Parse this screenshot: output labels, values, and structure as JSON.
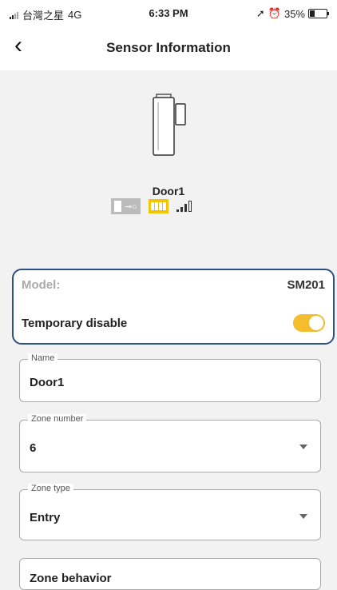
{
  "status_bar": {
    "carrier": "台灣之星",
    "network": "4G",
    "time": "6:33 PM",
    "battery_percent_label": "35%",
    "battery_level": 0.35
  },
  "nav": {
    "back_icon": "chevron-left-icon",
    "title": "Sensor Information"
  },
  "sensor": {
    "name": "Door1",
    "image_icon": "door-sensor-icon",
    "battery_icon": "battery-full-icon",
    "signal_icon": "signal-strength-icon"
  },
  "info": {
    "model_label": "Model:",
    "model_value": "SM201",
    "temporary_disable_label": "Temporary disable",
    "temporary_disable_on": true
  },
  "fields": {
    "name": {
      "label": "Name",
      "value": "Door1"
    },
    "zone_number": {
      "label": "Zone number",
      "value": "6"
    },
    "zone_type": {
      "label": "Zone type",
      "value": "Entry"
    },
    "zone_behavior": {
      "value": "Zone behavior"
    }
  },
  "colors": {
    "accent": "#f3bd2e",
    "card_border": "#2c4f86"
  }
}
